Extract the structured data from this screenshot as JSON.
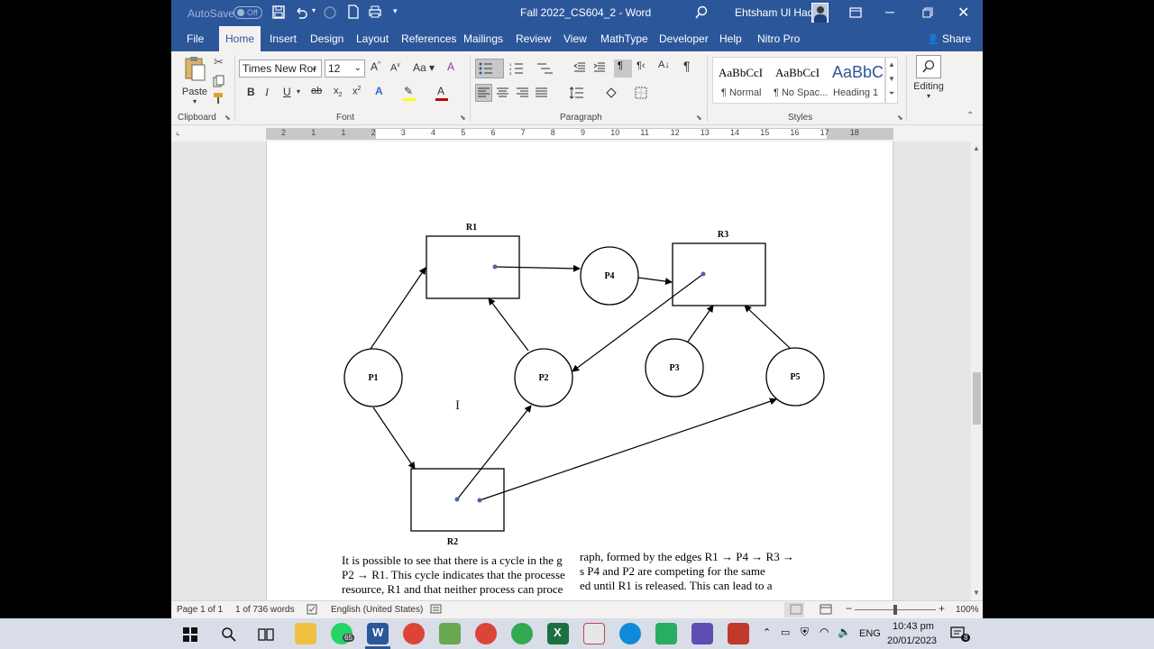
{
  "titlebar": {
    "autosave_label": "AutoSave",
    "autosave_state": "Off",
    "doc_title": "Fall 2022_CS604_2  -  Word",
    "user_name": "Ehtsham Ul Haq"
  },
  "ribbon_tabs": [
    "File",
    "Home",
    "Insert",
    "Design",
    "Layout",
    "References",
    "Mailings",
    "Review",
    "View",
    "MathType",
    "Developer",
    "Help",
    "Nitro Pro"
  ],
  "share_label": "Share",
  "clipboard": {
    "paste_label": "Paste",
    "group_label": "Clipboard"
  },
  "font": {
    "font_name": "Times New Ror",
    "font_size": "12",
    "group_label": "Font"
  },
  "paragraph": {
    "group_label": "Paragraph"
  },
  "styles": {
    "group_label": "Styles",
    "items": [
      {
        "preview": "AaBbCcI",
        "name": "¶ Normal"
      },
      {
        "preview": "AaBbCcI",
        "name": "¶ No Spac..."
      },
      {
        "preview": "AaBbC",
        "name": "Heading 1"
      }
    ]
  },
  "editing": {
    "label": "Editing"
  },
  "ruler_numbers": [
    "2",
    "1",
    "1",
    "2",
    "3",
    "4",
    "5",
    "6",
    "7",
    "8",
    "9",
    "10",
    "11",
    "12",
    "13",
    "14",
    "15",
    "16",
    "17",
    "18"
  ],
  "diagram": {
    "resources": [
      "R1",
      "R2",
      "R3"
    ],
    "processes": [
      "P1",
      "P2",
      "P3",
      "P4",
      "P5"
    ]
  },
  "document_text": {
    "line1a": "It is possible to see that there is a cycle in the g",
    "line1b": "raph, formed by the edges R1 → P4 → R3 →",
    "line2a": "P2 → R1. This cycle indicates that the processe",
    "line2b": "s P4 and P2 are competing for the same",
    "line3a": "resource, R1 and that neither process can proce",
    "line3b": "ed until R1 is released. This can lead to a"
  },
  "statusbar": {
    "page": "Page 1 of 1",
    "words": "1 of 736 words",
    "language": "English (United States)",
    "zoom": "100%"
  },
  "taskbar": {
    "whatsapp_badge": "65",
    "lang": "ENG",
    "time": "10:43 pm",
    "date": "20/01/2023",
    "notif_count": "8"
  },
  "colors": {
    "word_blue": "#2b579a",
    "ribbon_bg": "#f3f2f1",
    "taskbar_bg": "#d8dde8"
  }
}
